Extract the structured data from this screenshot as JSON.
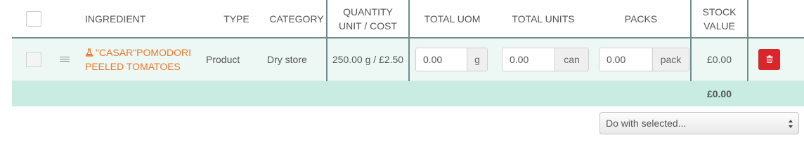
{
  "headers": {
    "ingredient": "INGREDIENT",
    "type": "TYPE",
    "category": "CATEGORY",
    "quantity_line1": "QUANTITY",
    "quantity_line2": "UNIT / COST",
    "total_uom": "TOTAL UOM",
    "total_units": "TOTAL UNITS",
    "packs": "PACKS",
    "stock_line1": "STOCK",
    "stock_line2": "VALUE"
  },
  "rows": [
    {
      "ingredient_line1": "\"CASAR\"POMODORI",
      "ingredient_line2": "PEELED TOMATOES",
      "type": "Product",
      "category": "Dry store",
      "quantity_cost": "250.00 g / £2.50",
      "total_uom": {
        "value": "0.00",
        "unit": "g"
      },
      "total_units": {
        "value": "0.00",
        "unit": "can"
      },
      "packs": {
        "value": "0.00",
        "unit": "pack"
      },
      "stock_value": "£0.00"
    }
  ],
  "total": {
    "stock_value": "£0.00"
  },
  "bulk_action": {
    "selected": "Do with selected..."
  },
  "icons": {
    "ingredient": "flask-icon",
    "drag": "drag-handle-icon",
    "delete": "trash-icon",
    "select": "select-arrows-icon"
  },
  "colors": {
    "accent_orange": "#e9782b",
    "row_bg": "#edf8f5",
    "total_bg": "#c8ebe2",
    "delete_red": "#d9262b",
    "separator": "#6f8d8a"
  }
}
